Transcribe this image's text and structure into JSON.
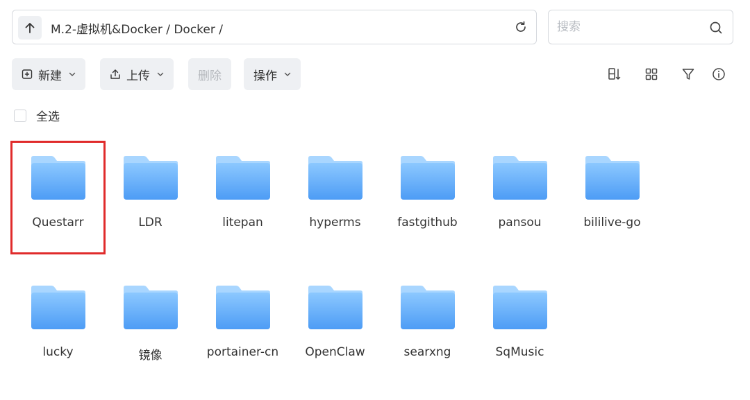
{
  "path": {
    "text": "M.2-虚拟机&Docker / Docker /"
  },
  "search": {
    "placeholder": "搜索"
  },
  "toolbar": {
    "new_label": "新建",
    "upload_label": "上传",
    "delete_label": "删除",
    "action_label": "操作"
  },
  "select_all_label": "全选",
  "folders": [
    {
      "name": "Questarr",
      "selected": true
    },
    {
      "name": "LDR"
    },
    {
      "name": "litepan"
    },
    {
      "name": "hyperms"
    },
    {
      "name": "fastgithub"
    },
    {
      "name": "pansou"
    },
    {
      "name": "bililive-go"
    },
    {
      "name": "lucky"
    },
    {
      "name": "镜像"
    },
    {
      "name": "portainer-cn"
    },
    {
      "name": "OpenClaw"
    },
    {
      "name": "searxng"
    },
    {
      "name": "SqMusic"
    }
  ],
  "colors": {
    "folder_top": "#8cc8ff",
    "folder_bottom": "#4d9cf5",
    "selection": "#e02b2b"
  }
}
